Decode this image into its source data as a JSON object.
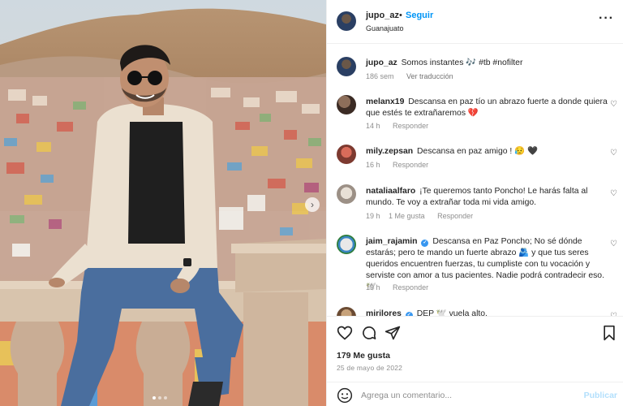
{
  "post": {
    "username": "jupo_az",
    "follow_label": "Seguir",
    "separator": "•",
    "location": "Guanajuato",
    "more_icon": "more-horizontal-icon"
  },
  "caption": {
    "username": "jupo_az",
    "text": "Somos instantes 🎶 #tb #nofilter",
    "age": "186 sem",
    "translate_label": "Ver traducción"
  },
  "comments": [
    {
      "username": "melanx19",
      "verified": false,
      "text": "Descansa en paz tío un abrazo fuerte a donde quiera que estés te extrañaremos 💔",
      "age": "14 h",
      "likes_label": "",
      "reply_label": "Responder"
    },
    {
      "username": "mily.zepsan",
      "verified": false,
      "text": "Descansa en paz amigo ! 😥 🖤",
      "age": "16 h",
      "likes_label": "",
      "reply_label": "Responder"
    },
    {
      "username": "nataliaalfaro",
      "verified": false,
      "text": "¡Te queremos tanto Poncho! Le harás falta al mundo. Te voy a extrañar toda mi vida amigo.",
      "age": "19 h",
      "likes_label": "1 Me gusta",
      "reply_label": "Responder"
    },
    {
      "username": "jaim_rajamin",
      "verified": true,
      "text": "Descansa en Paz Poncho; No sé dónde estarás; pero te mando un fuerte abrazo 🫂 y que tus seres queridos encuentren fuerzas, tu cumpliste con tu vocación y serviste con amor a tus pacientes. Nadie podrá contradecir eso. 🕊️",
      "age": "19 h",
      "likes_label": "",
      "reply_label": "Responder"
    },
    {
      "username": "mirilores",
      "verified": true,
      "text": "DEP 🕊️ vuela alto.",
      "age": "",
      "likes_label": "",
      "reply_label": ""
    }
  ],
  "stats": {
    "likes": "179 Me gusta",
    "date": "25 de mayo de 2022"
  },
  "composer": {
    "placeholder": "Agrega un comentario...",
    "post_label": "Publicar"
  },
  "colors": {
    "link_blue": "#0095f6",
    "post_disabled": "#b2dffc",
    "broken_heart": "#e0245e"
  }
}
